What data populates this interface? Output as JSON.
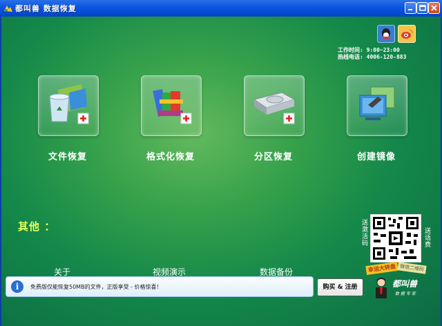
{
  "window": {
    "title": "都叫兽 数据恢复"
  },
  "contact": {
    "hours": "工作时间: 9:00~23:00",
    "phone": "热线电话: 4006-120-883"
  },
  "tiles": [
    {
      "label": "文件恢复",
      "icon": "recycle-bin-icon"
    },
    {
      "label": "格式化恢复",
      "icon": "archive-books-icon"
    },
    {
      "label": "分区恢复",
      "icon": "hard-drive-icon"
    },
    {
      "label": "创建镜像",
      "icon": "monitor-image-icon"
    }
  ],
  "other": {
    "title": "其他 ：",
    "links": [
      "关于",
      "视频演示",
      "数据备份"
    ]
  },
  "promo": {
    "left_text": "送激活码",
    "right_text": "送话费",
    "ribbon_left": "幸运大转盘",
    "ribbon_right": "微信二维码"
  },
  "status": {
    "message": "免费版仅能恢复50MB的文件，正版享受 - 价格惊喜！"
  },
  "buy_button": "购买 & 注册",
  "brand": {
    "name": "都叫兽",
    "tagline": "数 据 专 家"
  },
  "colors": {
    "background": "#1a8a4a",
    "titlebar": "#0a55e0",
    "accent_title": "#e8ff5a"
  }
}
